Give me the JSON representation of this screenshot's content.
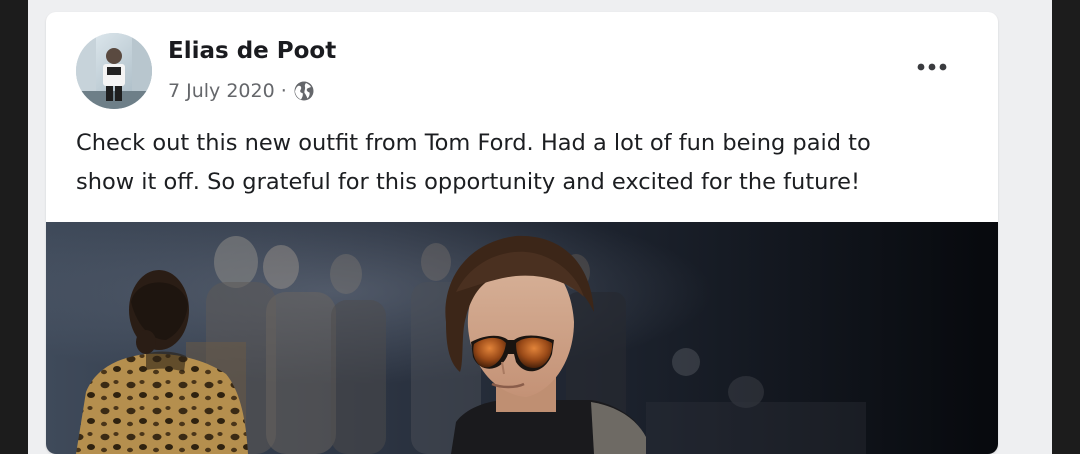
{
  "post": {
    "author": "Elias de Poot",
    "date": "7 July 2020",
    "separator": "·",
    "privacy_icon": "globe-icon",
    "more_icon": "more-options-icon",
    "text": "Check out this new outfit from Tom Ford. Had a lot of fun being paid to\nshow it off. So grateful for this opportunity and excited for the future!"
  },
  "colors": {
    "card_background": "#ffffff",
    "feed_background": "#eeeff1",
    "outer_background": "#1c1c1c",
    "name_text": "#1a1b1f",
    "meta_text": "#65676b",
    "body_text": "#1c1e21"
  }
}
